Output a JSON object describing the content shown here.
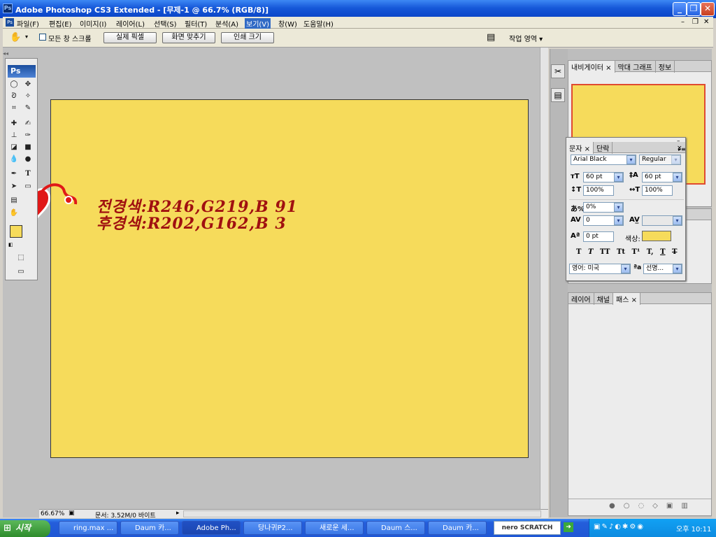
{
  "window": {
    "title": "Adobe Photoshop CS3 Extended - [무제-1 @ 66.7% (RGB/8)]",
    "ps_badge": "Ps"
  },
  "menu": [
    "파일(F)",
    "편집(E)",
    "이미지(I)",
    "레이어(L)",
    "선택(S)",
    "필터(T)",
    "분석(A)",
    "보기(V)",
    "창(W)",
    "도움말(H)"
  ],
  "menu_active": "보기(V)",
  "options": {
    "scroll_all_label": "모든 창 스크롤",
    "actual_pixels": "실제 픽셀",
    "fit_screen": "화면 맞추기",
    "print_size": "인쇄 크기",
    "workspace": "작업 영역 ▾"
  },
  "canvas": {
    "color": "#f6db5b",
    "line1": "전경색:R246,G219,B 91",
    "line2": "후경색:R202,G162,B  3"
  },
  "status": {
    "zoom": "66.67%",
    "doc": "문서: 3.52M/0 바이트"
  },
  "panels": {
    "navigator_tabs": [
      "내비게이터",
      "막대 그래프",
      "정보"
    ],
    "character_tabs": [
      "문자",
      "단락"
    ],
    "layers_tabs": [
      "레이어",
      "채널",
      "패스"
    ]
  },
  "character": {
    "font_family": "Arial Black",
    "font_style": "Regular",
    "size": "60 pt",
    "leading": "60 pt",
    "vscale": "100%",
    "hscale": "100%",
    "tracking_pct": "0%",
    "kerning": "0",
    "baseline": "0 pt",
    "color_label": "색상:",
    "color": "#f6db5b",
    "language": "영어: 미국",
    "aa_icon": "ªa",
    "antialias": "선명...",
    "style_buttons": [
      "T",
      "T",
      "TT",
      "Tt",
      "T¹",
      "T,",
      "T",
      "T"
    ]
  },
  "taskbar": {
    "start": "시작",
    "items": [
      "ring.max ...",
      "Daum 카...",
      "Adobe Ph...",
      "당나귀P2...",
      "새로운 세...",
      "Daum 스...",
      "Daum 카..."
    ],
    "active_index": 2,
    "nero": "nero SCRATCH",
    "clock": "오후 10:11"
  }
}
